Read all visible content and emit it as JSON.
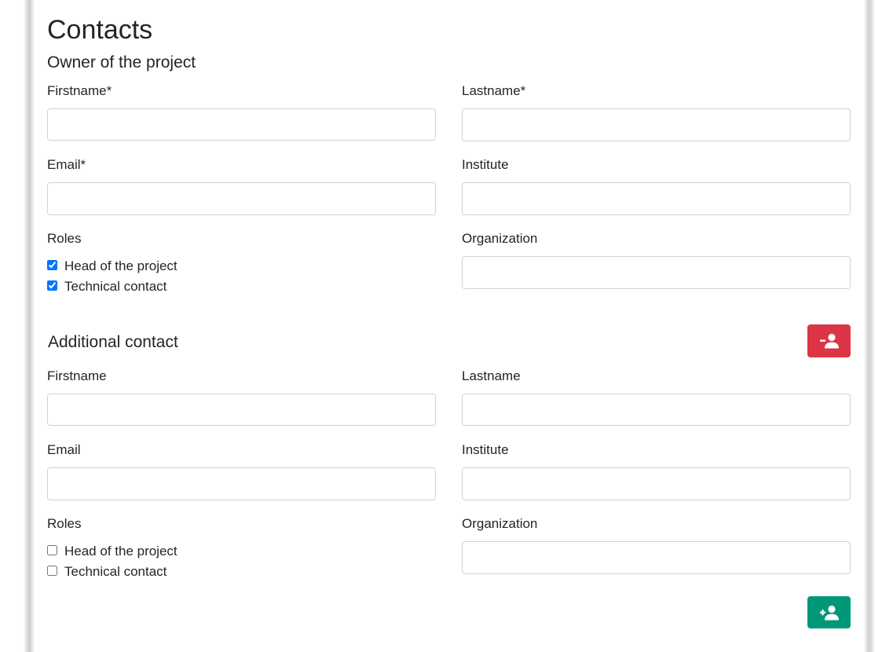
{
  "page": {
    "title": "Contacts"
  },
  "owner": {
    "heading": "Owner of the project",
    "firstname_label": "Firstname*",
    "lastname_label": "Lastname*",
    "email_label": "Email*",
    "institute_label": "Institute",
    "roles_label": "Roles",
    "organization_label": "Organization",
    "roles": [
      {
        "label": "Head of the project",
        "checked": true
      },
      {
        "label": "Technical contact",
        "checked": true
      }
    ],
    "values": {
      "firstname": "",
      "lastname": "",
      "email": "",
      "institute": "",
      "organization": ""
    }
  },
  "additional": {
    "heading": "Additional contact",
    "firstname_label": "Firstname",
    "lastname_label": "Lastname",
    "email_label": "Email",
    "institute_label": "Institute",
    "roles_label": "Roles",
    "organization_label": "Organization",
    "roles": [
      {
        "label": "Head of the project",
        "checked": false
      },
      {
        "label": "Technical contact",
        "checked": false
      }
    ],
    "values": {
      "firstname": "",
      "lastname": "",
      "email": "",
      "institute": "",
      "organization": ""
    },
    "remove_button": {
      "icon": "user-minus-icon",
      "color": "#dc3545"
    },
    "add_button": {
      "icon": "user-plus-icon",
      "color": "#009879"
    }
  }
}
